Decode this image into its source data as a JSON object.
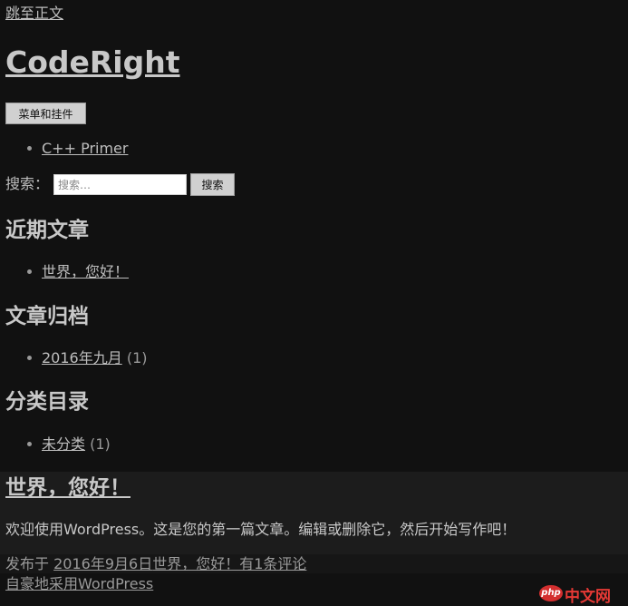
{
  "skip_link": "跳至正文",
  "site": {
    "title": "CodeRight",
    "menu_button": "菜单和挂件"
  },
  "nav": {
    "items": [
      {
        "label": "C++ Primer"
      }
    ]
  },
  "search": {
    "label": "搜索：",
    "placeholder": "搜索…",
    "button": "搜索"
  },
  "widgets": {
    "recent_posts": {
      "title": "近期文章",
      "items": [
        {
          "label": "世界，您好！"
        }
      ]
    },
    "archives": {
      "title": "文章归档",
      "items": [
        {
          "label": "2016年九月",
          "count": "(1)"
        }
      ]
    },
    "categories": {
      "title": "分类目录",
      "items": [
        {
          "label": "未分类",
          "count": "(1)"
        }
      ]
    }
  },
  "post": {
    "title": "世界，您好！",
    "content": "欢迎使用WordPress。这是您的第一篇文章。编辑或删除它，然后开始写作吧！",
    "meta": {
      "posted_on": "发布于",
      "date": "2016年9月6日",
      "comments_link": "世界，您好！有1条评论"
    }
  },
  "footer": {
    "credit": "自豪地采用WordPress"
  },
  "watermark": {
    "badge": "php",
    "text": "中文网"
  },
  "colors": {
    "background": "#111111",
    "text": "#bdbdbd",
    "post_background": "#1c1c1c",
    "watermark": "#e53935"
  }
}
